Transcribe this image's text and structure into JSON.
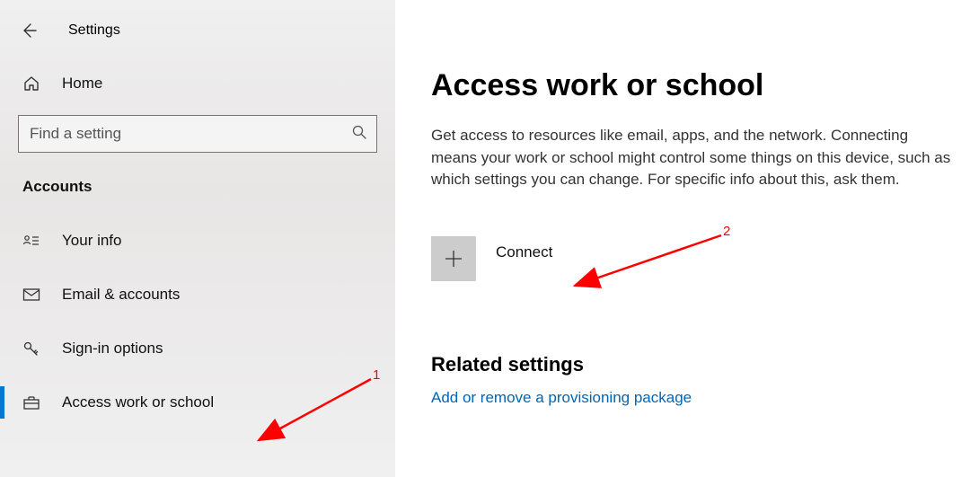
{
  "app": {
    "title": "Settings"
  },
  "sidebar": {
    "home_label": "Home",
    "search_placeholder": "Find a setting",
    "category": "Accounts",
    "items": [
      {
        "label": "Your info",
        "icon": "user-card-icon",
        "selected": false
      },
      {
        "label": "Email & accounts",
        "icon": "mail-icon",
        "selected": false
      },
      {
        "label": "Sign-in options",
        "icon": "key-icon",
        "selected": false
      },
      {
        "label": "Access work or school",
        "icon": "briefcase-icon",
        "selected": true
      }
    ]
  },
  "main": {
    "title": "Access work or school",
    "description": "Get access to resources like email, apps, and the network. Connecting means your work or school might control some things on this device, such as which settings you can change. For specific info about this, ask them.",
    "connect_label": "Connect",
    "related_heading": "Related settings",
    "related_link": "Add or remove a provisioning package"
  },
  "annotations": {
    "label1": "1",
    "label2": "2"
  }
}
